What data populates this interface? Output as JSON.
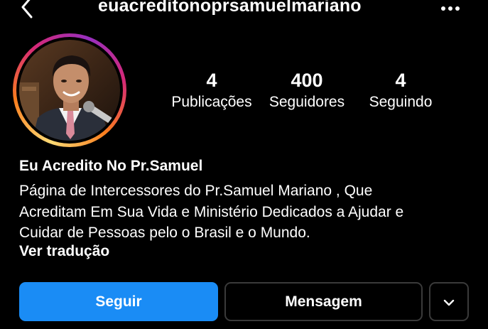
{
  "header": {
    "back_icon": "chevron-left-icon",
    "username": "euacreditonoprsamuelmariano",
    "more_icon": "more-horizontal-icon"
  },
  "profile": {
    "avatar_icon": "profile-photo",
    "story_ring_colors": [
      "#feda75",
      "#fa7e1e",
      "#d62976",
      "#962fbf"
    ]
  },
  "stats": [
    {
      "value": "4",
      "label": "Publicações"
    },
    {
      "value": "400",
      "label": "Seguidores"
    },
    {
      "value": "4",
      "label": "Seguindo"
    }
  ],
  "bio": {
    "name": "Eu Acredito No Pr.Samuel",
    "text": "Página de Intercessores do Pr.Samuel Mariano , Que\nAcreditam Em Sua Vida e Ministério Dedicados a Ajudar e\nCuidar de Pessoas pelo o Brasil e o Mundo.",
    "translate_label": "Ver tradução"
  },
  "actions": {
    "follow_label": "Seguir",
    "message_label": "Mensagem",
    "expand_icon": "chevron-down-icon"
  },
  "colors": {
    "background": "#000000",
    "follow_button": "#1a8cf5",
    "button_border": "#3a3a3a"
  }
}
